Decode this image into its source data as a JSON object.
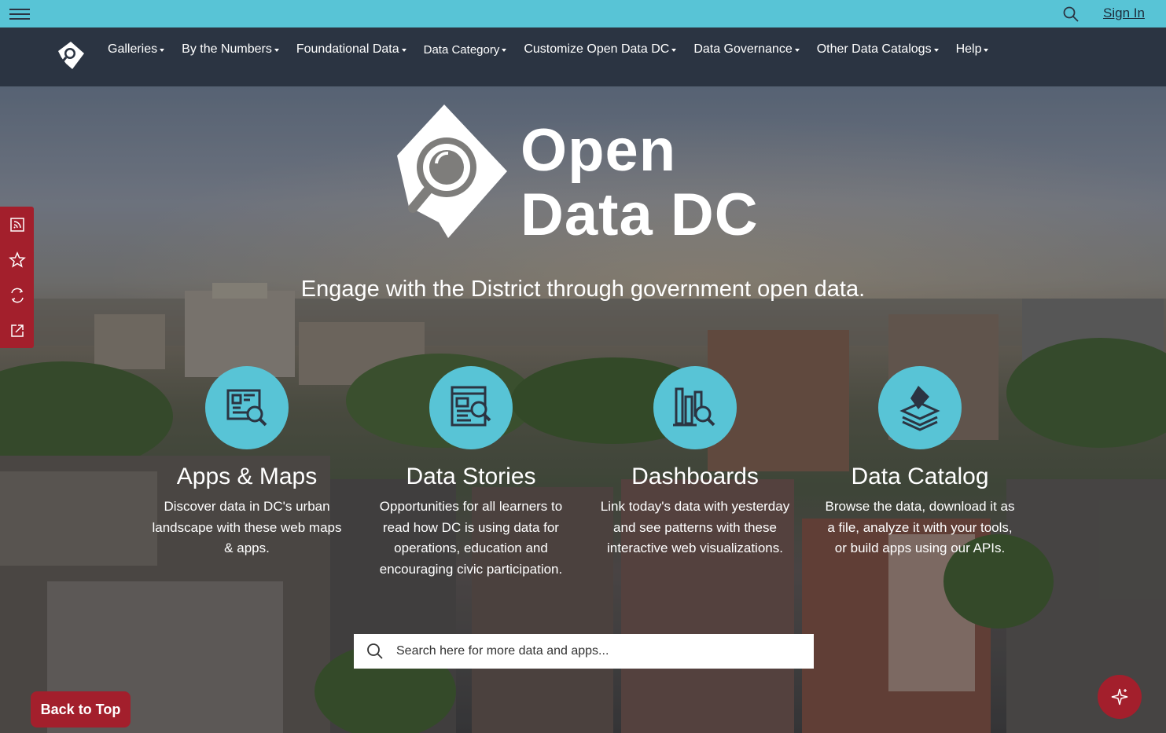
{
  "topbar": {
    "signin_label": "Sign In",
    "menu_icon": "hamburger-menu-icon",
    "search_icon": "search-icon"
  },
  "nav": {
    "logo": "open-data-dc-logo",
    "items": [
      {
        "label": "Galleries"
      },
      {
        "label": "By the Numbers"
      },
      {
        "label": "Foundational Data"
      },
      {
        "label": "Data Category"
      },
      {
        "label": "Customize Open Data DC"
      },
      {
        "label": "Data Governance"
      },
      {
        "label": "Other Data Catalogs"
      },
      {
        "label": "Help"
      }
    ]
  },
  "hero": {
    "brand_line1": "Open",
    "brand_line2": "Data DC",
    "tagline": "Engage with the District through government open data.",
    "features": [
      {
        "title": "Apps & Maps",
        "desc": "Discover data in DC's urban landscape with these web maps & apps.",
        "icon": "map-search-icon"
      },
      {
        "title": "Data Stories",
        "desc": "Opportunities for all learners to read how DC is using data for operations, education and encouraging civic participation.",
        "icon": "story-search-icon"
      },
      {
        "title": "Dashboards",
        "desc": "Link today's data with yesterday and see patterns with these interactive web visualizations.",
        "icon": "chart-search-icon"
      },
      {
        "title": "Data Catalog",
        "desc": "Browse the data, download it as a file, analyze it with your tools, or build apps using our APIs.",
        "icon": "layers-icon"
      }
    ],
    "search": {
      "placeholder": "Search here for more data and apps..."
    }
  },
  "rail": {
    "icons": [
      "rss-icon",
      "star-icon",
      "translate-icon",
      "share-icon"
    ]
  },
  "back_to_top_label": "Back to Top",
  "colors": {
    "accent": "#58c4d6",
    "nav_bg": "#2b3442",
    "brand_red": "#a31f2c"
  }
}
